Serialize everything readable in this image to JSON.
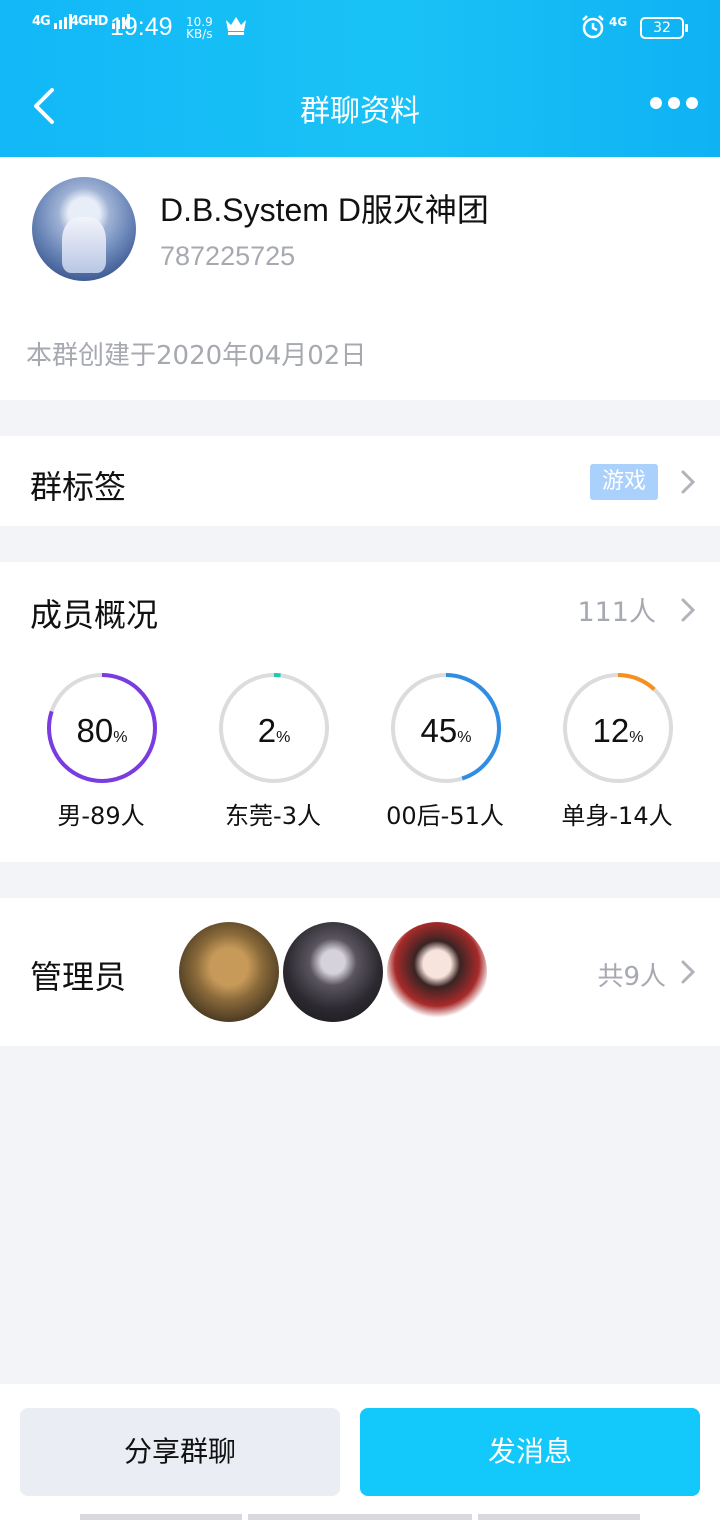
{
  "status_bar": {
    "network1": "4G",
    "network2": "4GHD",
    "time": "19:49",
    "speed_value": "10.9",
    "speed_unit": "KB/s",
    "network3": "4G",
    "battery": "32"
  },
  "nav": {
    "title": "群聊资料"
  },
  "profile": {
    "name": "D.B.System D服灭神团",
    "id": "787225725",
    "created": "本群创建于2020年04月02日"
  },
  "tags": {
    "title": "群标签",
    "tag": "游戏"
  },
  "members": {
    "title": "成员概况",
    "count": "111人",
    "stats": [
      {
        "value": "80",
        "unit": "%",
        "label": "男-89人",
        "fraction": 0.8,
        "color": "#7a3be0"
      },
      {
        "value": "2",
        "unit": "%",
        "label": "东莞-3人",
        "fraction": 0.02,
        "color": "#20c9b4"
      },
      {
        "value": "45",
        "unit": "%",
        "label": "00后-51人",
        "fraction": 0.45,
        "color": "#2f8de4"
      },
      {
        "value": "12",
        "unit": "%",
        "label": "单身-14人",
        "fraction": 0.12,
        "color": "#f5901e"
      }
    ]
  },
  "admins": {
    "title": "管理员",
    "count": "共9人"
  },
  "buttons": {
    "share": "分享群聊",
    "send": "发消息"
  }
}
